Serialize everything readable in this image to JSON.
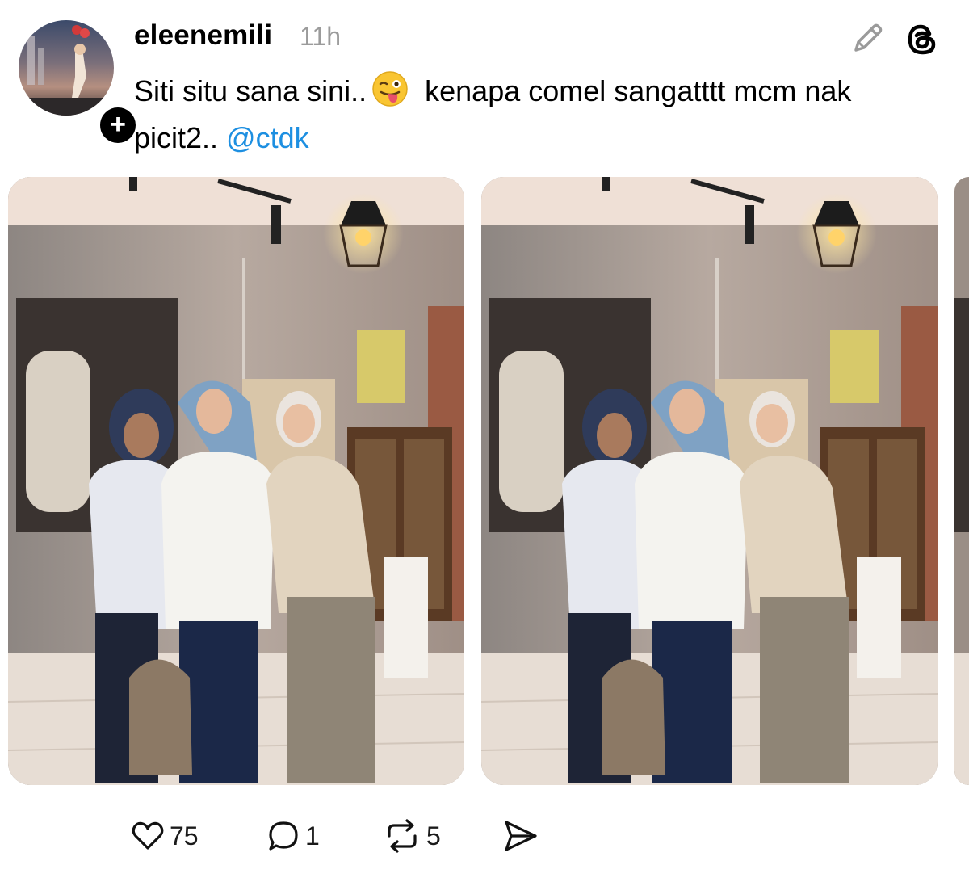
{
  "post": {
    "username": "eleenemili",
    "time": "11h",
    "text_part1": "Siti situ sana sini..",
    "text_part2": " kenapa comel sangatttt mcm nak picit2.. ",
    "mention": "@ctdk",
    "emoji_icon": "winking-face-with-tongue"
  },
  "avatar": {
    "badge_icon": "plus-icon"
  },
  "header_icons": [
    "pencil-edit-icon",
    "threads-logo-icon"
  ],
  "photos": [
    "group-photo-1",
    "group-photo-2",
    "group-photo-3-partial"
  ],
  "actions": {
    "likes": "75",
    "replies": "1",
    "reposts": "5",
    "share_icon": "send-icon"
  },
  "colors": {
    "mention": "#1d8fe1",
    "timestamp": "#9b9b9b"
  }
}
